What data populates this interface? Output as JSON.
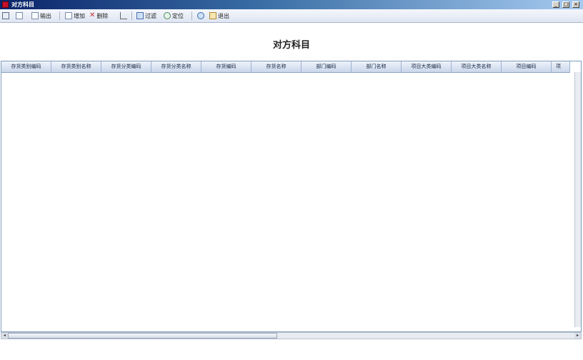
{
  "window": {
    "title": "对方科目",
    "controls": [
      "_",
      "□",
      "×"
    ]
  },
  "toolbar": {
    "output_label": "输出",
    "add_label": "增加",
    "delete_label": "删除",
    "filter_label": "过滤",
    "locate_label": "定位",
    "exit_label": "退出"
  },
  "report": {
    "title": "对方科目"
  },
  "table": {
    "columns": [
      "存货类别编码",
      "存货类别名称",
      "存货分类编码",
      "存货分类名称",
      "存货编码",
      "存货名称",
      "部门编码",
      "部门名称",
      "项目大类编码",
      "项目大类名称",
      "项目编码",
      "项"
    ],
    "rows": []
  },
  "scrollbar": {
    "left_arrow": "◂",
    "right_arrow": "▸"
  }
}
